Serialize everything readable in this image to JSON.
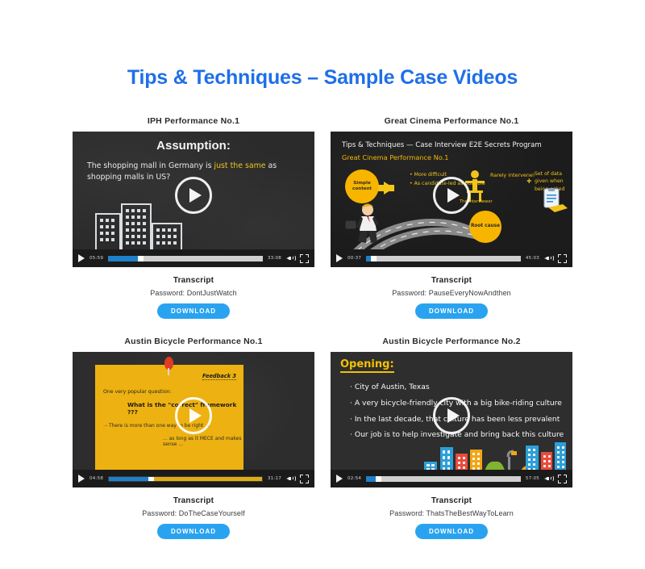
{
  "page": {
    "title": "Tips & Techniques – Sample Case Videos",
    "accent_color": "#1f6fe8",
    "download_button_color": "#29a3f0",
    "background": "#ffffff"
  },
  "labels": {
    "transcript": "Transcript",
    "download": "DOWNLOAD"
  },
  "videos": [
    {
      "title": "IPH Performance No.1",
      "current_time": "05:59",
      "duration": "33:08",
      "progress_percent": 19,
      "buffered_percent": 100,
      "transcript_label": "Transcript",
      "password_text": "Password: DontJustWatch",
      "download_label": "DOWNLOAD",
      "slide": {
        "heading": "Assumption:",
        "body_before": "The shopping mall in Germany is ",
        "body_highlight": "just the same",
        "body_after": " as shopping malls in US?"
      }
    },
    {
      "title": "Great Cinema Performance No.1",
      "current_time": "00:37",
      "duration": "45:03",
      "progress_percent": 3,
      "buffered_percent": 100,
      "transcript_label": "Transcript",
      "password_text": "Password: PauseEveryNowAndthen",
      "download_label": "DOWNLOAD",
      "slide": {
        "line1": "Tips & Techniques — Case Interview E2E Secrets Program",
        "line2": "Great Cinema Performance No.1",
        "simple_context": "Simple context",
        "bullet1": "• More difficult",
        "bullet2": "• As candidate-led as possible",
        "rarely": "Rarely intervene!",
        "plus": "+",
        "dataset": "Set of data given when being asked",
        "interviewer": "The interviewer",
        "root_cause": "Root cause"
      }
    },
    {
      "title": "Austin Bicycle Performance No.1",
      "current_time": "04:58",
      "duration": "31:17",
      "progress_percent": 26,
      "buffered_percent": 100,
      "transcript_label": "Transcript",
      "password_text": "Password: DoTheCaseYourself",
      "download_label": "DOWNLOAD",
      "slide": {
        "feedback": "Feedback 3",
        "question_intro": "One very popular question:",
        "question": "What is the \"correct\" framework ???",
        "answer1": "There is more than one way to be right ...",
        "answer2": "... as long as it MECE and makes sense ..."
      }
    },
    {
      "title": "Austin Bicycle Performance No.2",
      "current_time": "02:54",
      "duration": "57:05",
      "progress_percent": 6,
      "buffered_percent": 100,
      "transcript_label": "Transcript",
      "password_text": "Password: ThatsTheBestWayToLearn",
      "download_label": "DOWNLOAD",
      "slide": {
        "heading": "Opening:",
        "bullets": [
          "City of Austin, Texas",
          "A very bicycle-friendly city with a big bike-riding culture",
          "In the last decade, that culture has been less prevalent",
          "Our job is to help investigate and bring back this culture"
        ]
      }
    }
  ]
}
